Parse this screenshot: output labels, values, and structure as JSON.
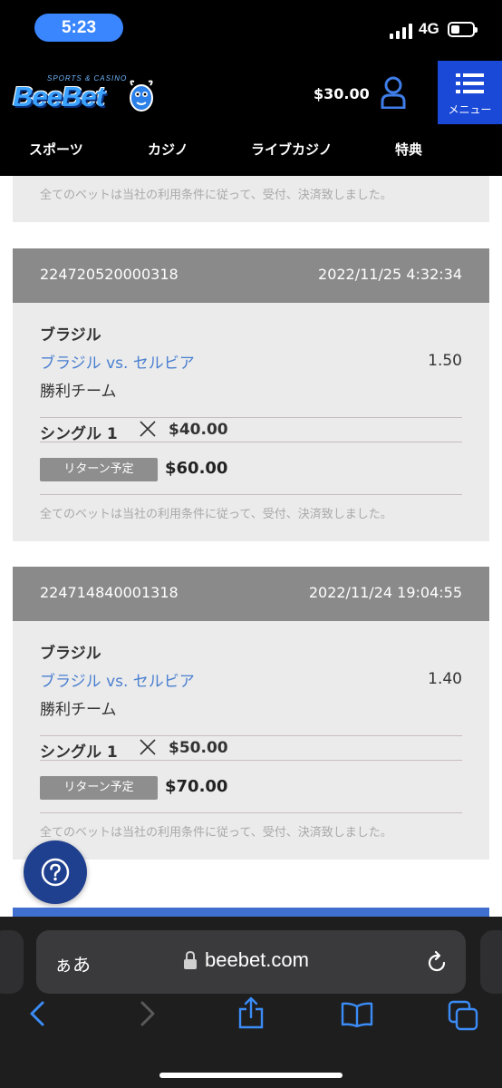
{
  "status_bar": {
    "time": "5:23",
    "network": "4G"
  },
  "header": {
    "logo_text": "BeeBet",
    "logo_sub": "SPORTS & CASINO",
    "balance": "$30.00",
    "menu_label": "メニュー"
  },
  "nav": {
    "items": [
      {
        "label": "スポーツ"
      },
      {
        "label": "カジノ"
      },
      {
        "label": "ライブカジノ"
      },
      {
        "label": "特典"
      }
    ]
  },
  "disclaimer_text": "全てのベットは当社の利用条件に従って、受付、決済致しました。",
  "bets": [
    {
      "id": "224720520000318",
      "datetime": "2022/11/25  4:32:34",
      "league": "ブラジル",
      "match": "ブラジル vs. セルビア",
      "odds": "1.50",
      "market": "勝利チーム",
      "bet_type": "シングル 1",
      "stake": "$40.00",
      "return_label": "リターン予定",
      "return_amount": "$60.00",
      "disclaimer": "全てのベットは当社の利用条件に従って、受付、決済致しました。"
    },
    {
      "id": "224714840001318",
      "datetime": "2022/11/24  19:04:55",
      "league": "ブラジル",
      "match": "ブラジル vs. セルビア",
      "odds": "1.40",
      "market": "勝利チーム",
      "bet_type": "シングル 1",
      "stake": "$50.00",
      "return_label": "リターン予定",
      "return_amount": "$70.00",
      "disclaimer": "全てのベットは当社の利用条件に従って、受付、決済致しました。"
    }
  ],
  "browser": {
    "aa_label": "ぁあ",
    "url": "beebet.com"
  },
  "colors": {
    "brand_blue": "#1a49d8",
    "link_blue": "#4a7fd0",
    "card_header_gray": "#8a8a8a",
    "card_bg": "#ebebeb"
  },
  "icons": [
    "user-icon",
    "menu-icon",
    "times-icon",
    "help-icon",
    "lock-icon",
    "reload-icon",
    "back-icon",
    "forward-icon",
    "share-icon",
    "bookmarks-icon",
    "tabs-icon"
  ]
}
